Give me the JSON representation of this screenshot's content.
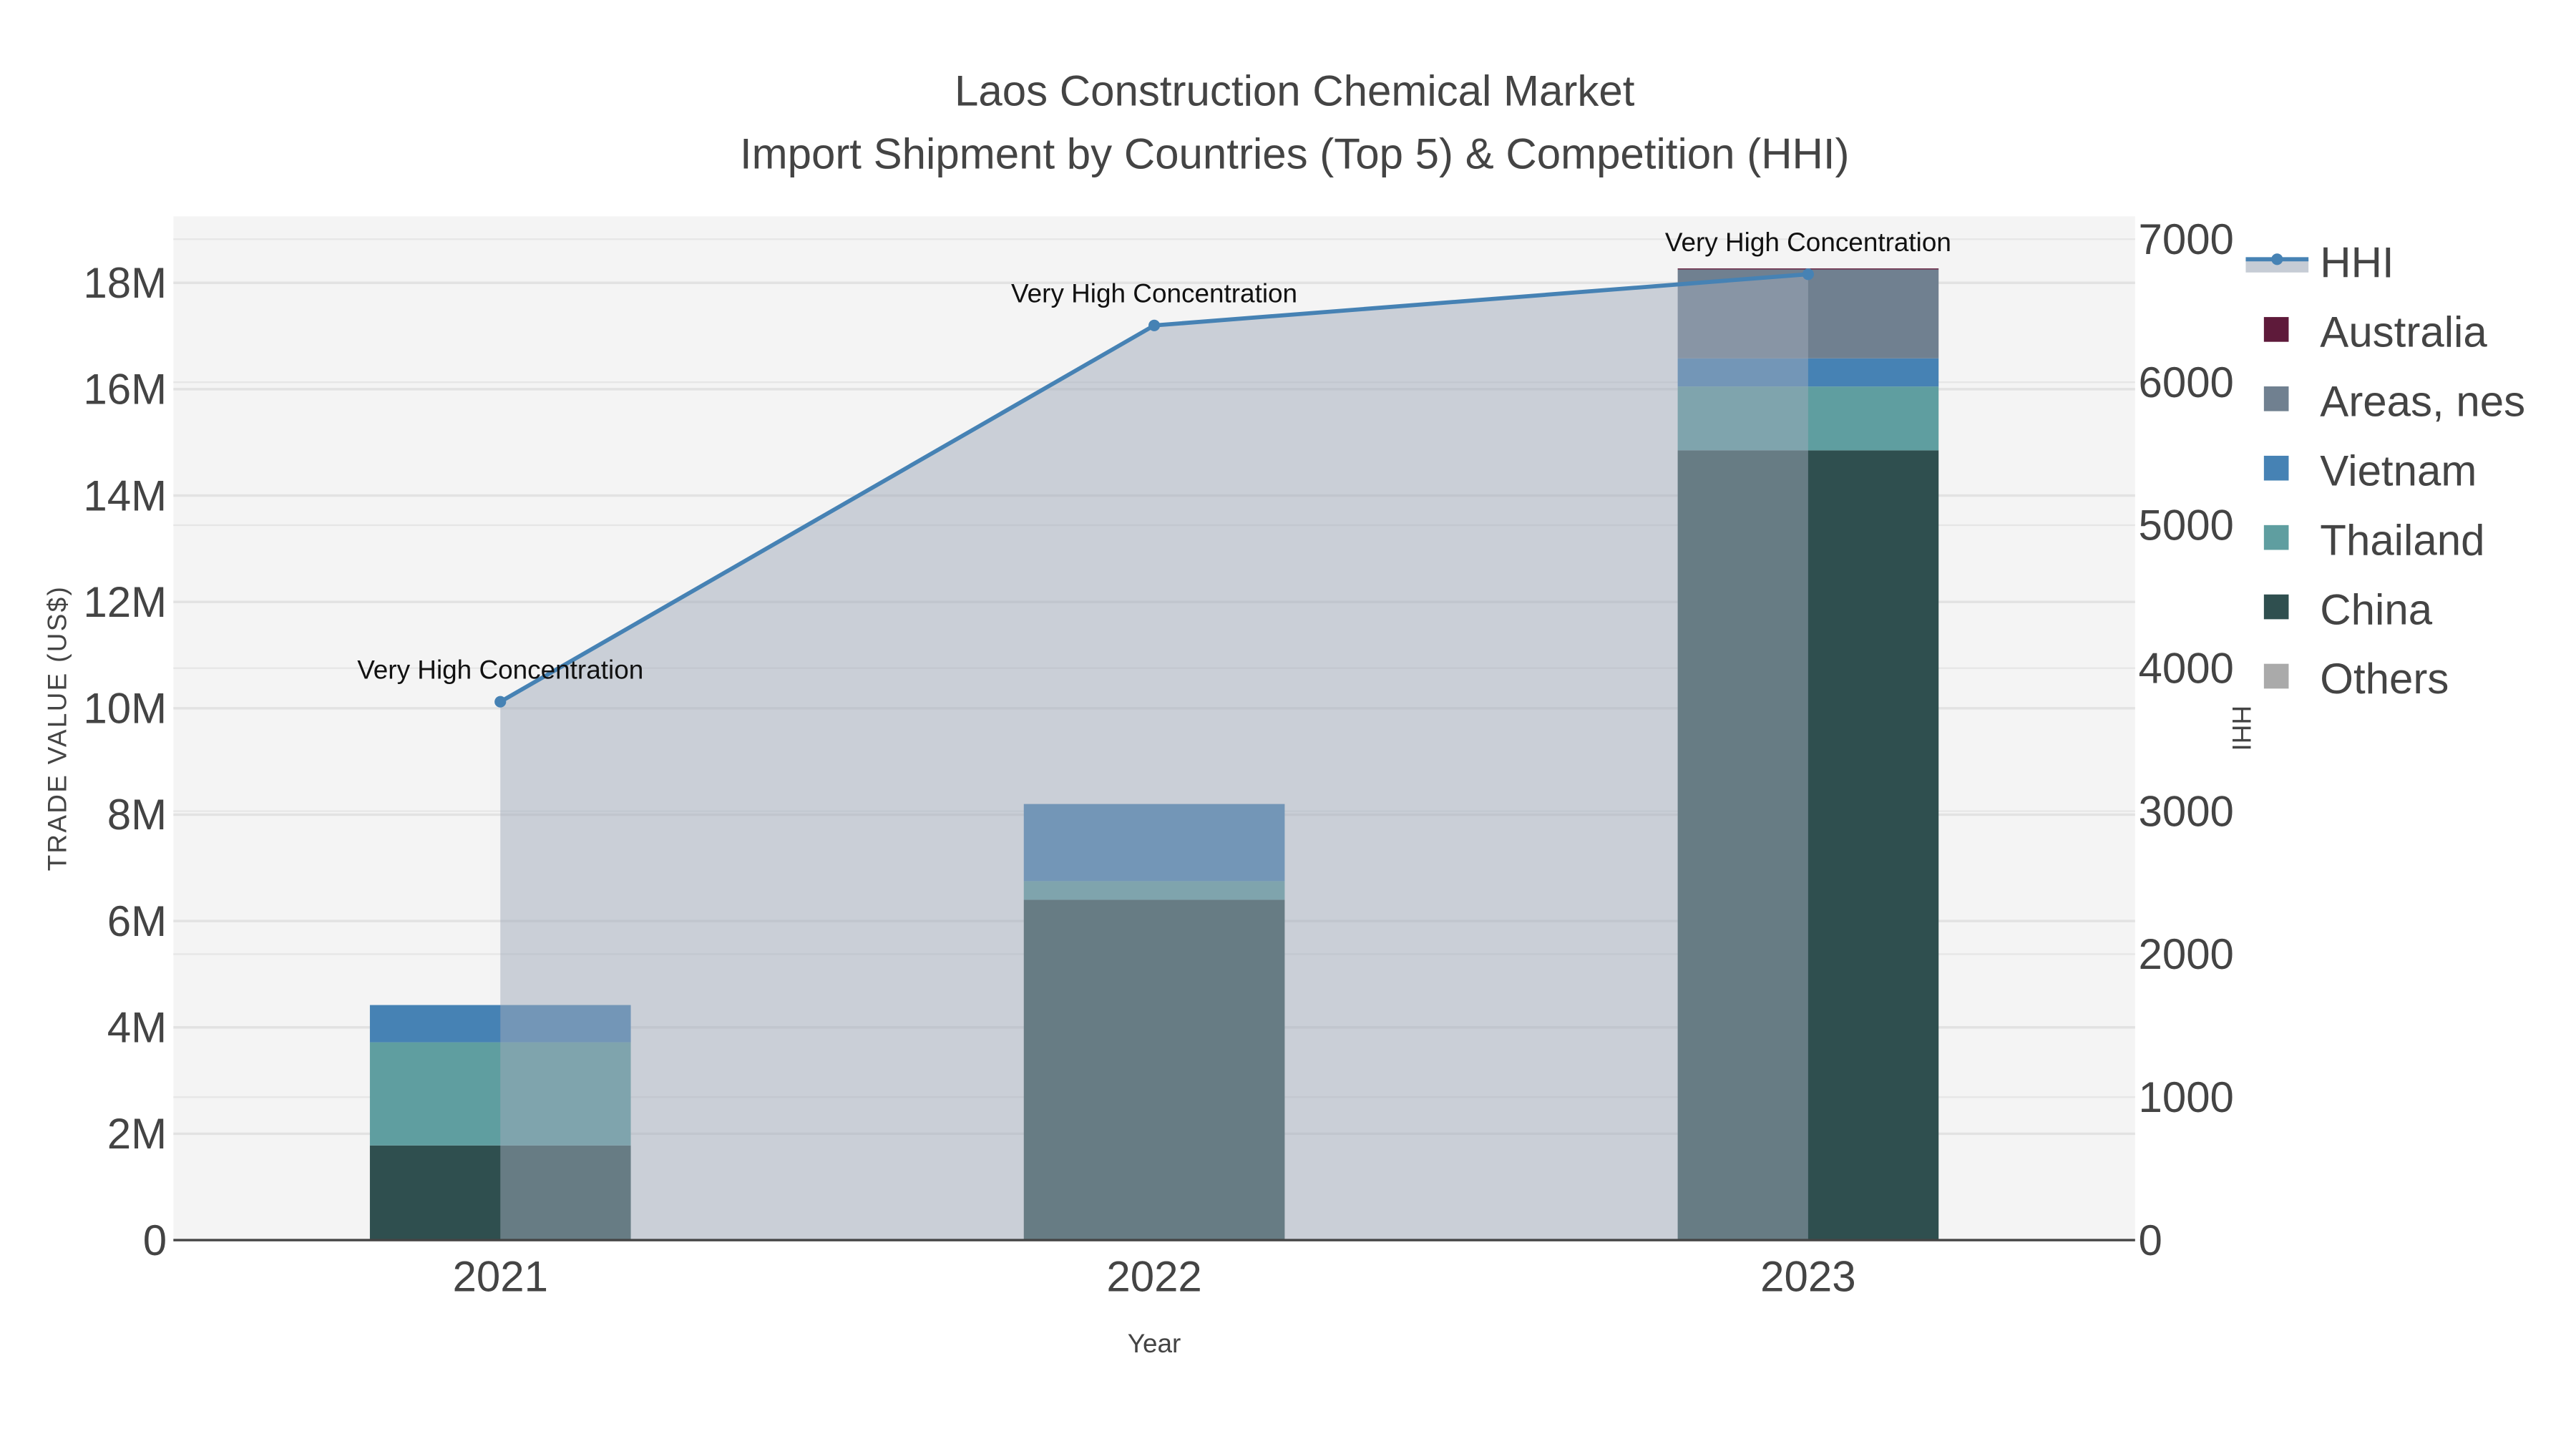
{
  "chart_data": {
    "type": "bar",
    "title": "Laos Construction Chemical Market",
    "subtitle": "Import Shipment by Countries (Top 5) & Competition (HHI)",
    "xlabel": "Year",
    "ylabel": "TRADE VALUE (US$)",
    "y2label": "HHI",
    "categories": [
      "2021",
      "2022",
      "2023"
    ],
    "ylim": [
      0,
      19250000
    ],
    "y2lim": [
      0,
      7160
    ],
    "yticks": [
      0,
      2000000,
      4000000,
      6000000,
      8000000,
      10000000,
      12000000,
      14000000,
      16000000,
      18000000
    ],
    "ytick_labels": [
      "0",
      "2M",
      "4M",
      "6M",
      "8M",
      "10M",
      "12M",
      "14M",
      "16M",
      "18M"
    ],
    "y2ticks": [
      0,
      1000,
      2000,
      3000,
      4000,
      5000,
      6000,
      7000
    ],
    "y2tick_labels": [
      "0",
      "1000",
      "2000",
      "3000",
      "4000",
      "5000",
      "6000",
      "7000"
    ],
    "series": [
      {
        "name": "China",
        "color": "#2f4f4f",
        "values": [
          1780000,
          6400000,
          14850000
        ]
      },
      {
        "name": "Thailand",
        "color": "#5f9ea0",
        "values": [
          1940000,
          350000,
          1200000
        ]
      },
      {
        "name": "Vietnam",
        "color": "#4682b4",
        "values": [
          700000,
          1450000,
          530000
        ]
      },
      {
        "name": "Areas, nes",
        "color": "#708090",
        "values": [
          0,
          0,
          1670000
        ]
      },
      {
        "name": "Australia",
        "color": "#5e1a3a",
        "values": [
          0,
          0,
          20000
        ]
      },
      {
        "name": "Others",
        "color": "#aaaaaa",
        "values": [
          0,
          0,
          0
        ]
      }
    ],
    "hhi": {
      "name": "HHI",
      "color": "#4682b4",
      "values": [
        3765,
        6397,
        6755
      ],
      "annotations": [
        "Very High Concentration",
        "Very High Concentration",
        "Very High Concentration"
      ]
    },
    "legend": [
      "HHI",
      "Australia",
      "Areas, nes",
      "Vietnam",
      "Thailand",
      "China",
      "Others"
    ],
    "legend_position": "right",
    "grid": true
  }
}
